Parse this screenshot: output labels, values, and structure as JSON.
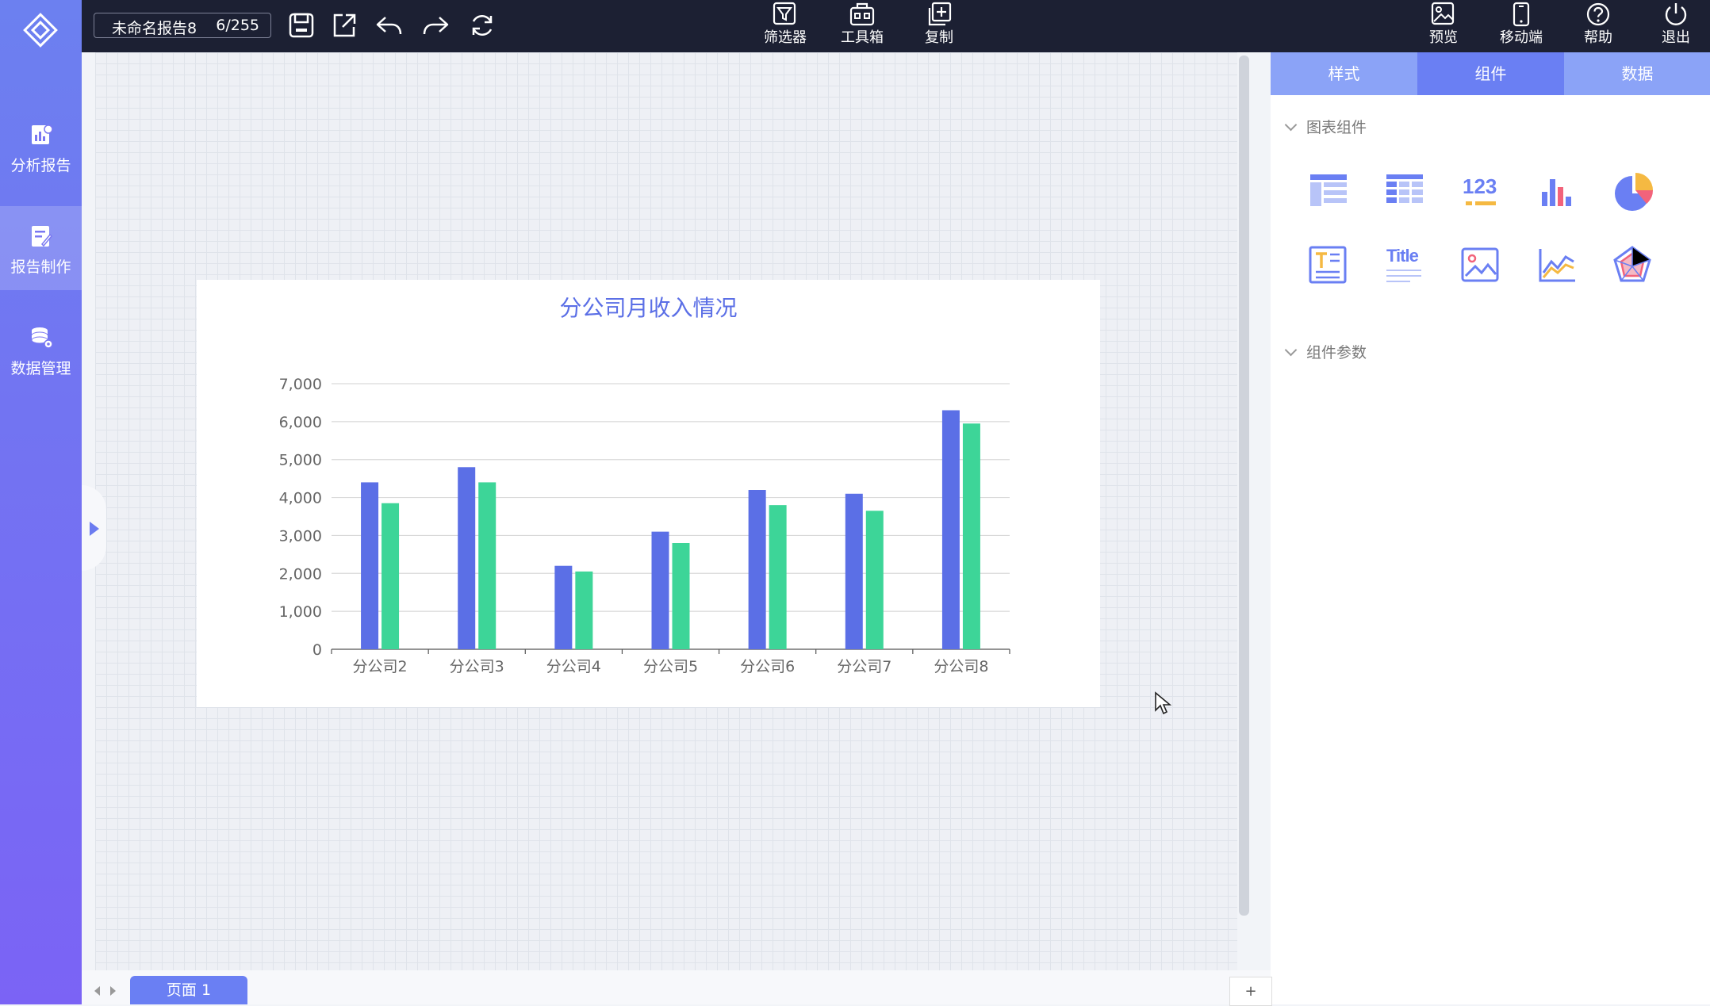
{
  "sidebar": {
    "items": [
      {
        "label": "分析报告",
        "icon": "chart-report-icon"
      },
      {
        "label": "报告制作",
        "icon": "report-edit-icon"
      },
      {
        "label": "数据管理",
        "icon": "database-gear-icon"
      }
    ]
  },
  "toolbar": {
    "report_name": "未命名报告8",
    "char_count": "6/255",
    "center": [
      {
        "label": "筛选器",
        "icon": "filter-icon"
      },
      {
        "label": "工具箱",
        "icon": "toolbox-icon"
      },
      {
        "label": "复制",
        "icon": "copy-icon"
      }
    ],
    "right": [
      {
        "label": "预览",
        "icon": "preview-icon"
      },
      {
        "label": "移动端",
        "icon": "mobile-icon"
      },
      {
        "label": "帮助",
        "icon": "help-icon"
      },
      {
        "label": "退出",
        "icon": "power-icon"
      }
    ]
  },
  "right_panel": {
    "tabs": [
      "样式",
      "组件",
      "数据"
    ],
    "active_tab": "组件",
    "section_chart": "图表组件",
    "section_params": "组件参数",
    "number_icon_text": "123",
    "title_icon_text": "Title"
  },
  "bottom": {
    "page_tab": "页面 1",
    "add_label": "+"
  },
  "colors": {
    "accent": "#6a7ff3",
    "series1": "#5b6fe6",
    "series2": "#3dd598"
  },
  "chart_data": {
    "type": "bar",
    "title": "分公司月收入情况",
    "categories": [
      "分公司2",
      "分公司3",
      "分公司4",
      "分公司5",
      "分公司6",
      "分公司7",
      "分公司8"
    ],
    "series": [
      {
        "values": [
          4400,
          4800,
          2200,
          3100,
          4200,
          4100,
          6300
        ]
      },
      {
        "values": [
          3850,
          4400,
          2050,
          2800,
          3800,
          3650,
          5950
        ]
      }
    ],
    "ylim": [
      0,
      7000
    ],
    "yticks": [
      0,
      1000,
      2000,
      3000,
      4000,
      5000,
      6000,
      7000
    ],
    "ytick_labels": [
      "0",
      "1,000",
      "2,000",
      "3,000",
      "4,000",
      "5,000",
      "6,000",
      "7,000"
    ],
    "grid": true,
    "xlabel": "",
    "ylabel": ""
  }
}
